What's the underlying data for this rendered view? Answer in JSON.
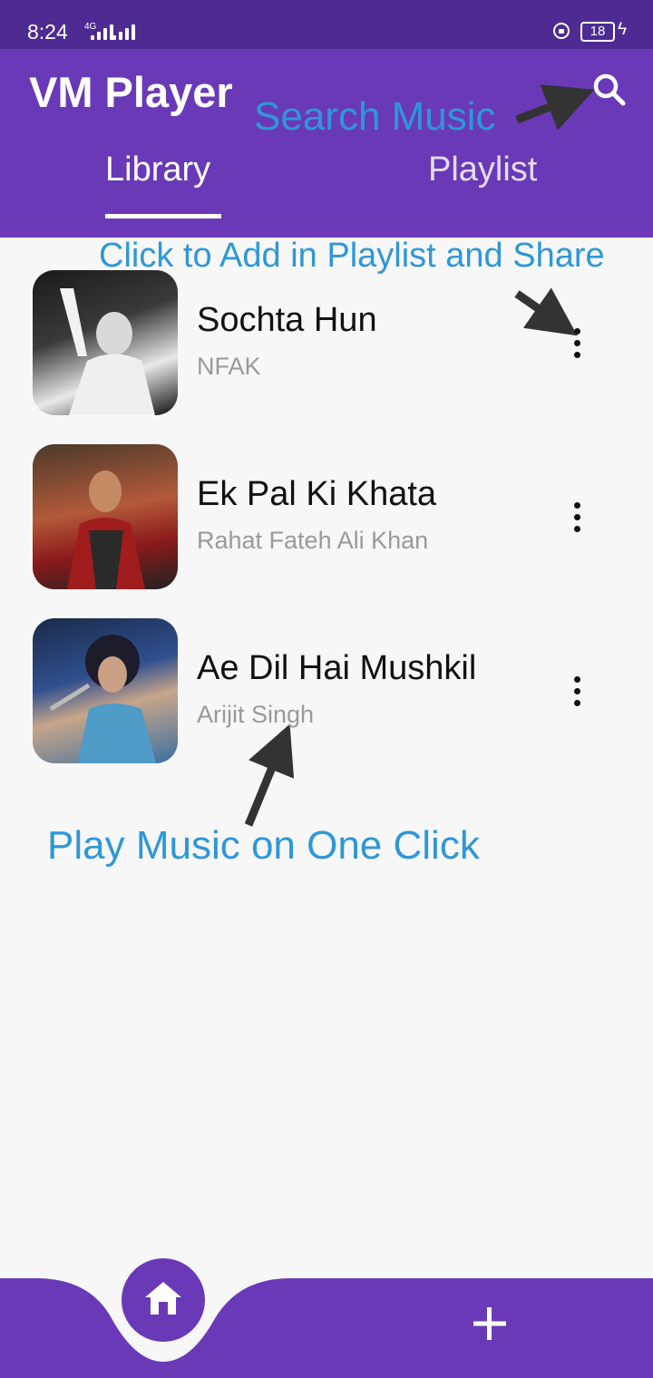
{
  "status_bar": {
    "time": "8:24",
    "network": "4G",
    "battery": "18"
  },
  "app": {
    "title": "VM Player",
    "tabs": [
      {
        "label": "Library",
        "selected": true
      },
      {
        "label": "Playlist",
        "selected": false
      }
    ]
  },
  "annotations": {
    "search": "Search Music",
    "menu": "Click to Add in Playlist and Share",
    "play": "Play Music on One Click"
  },
  "songs": [
    {
      "title": "Sochta Hun",
      "artist": "NFAK"
    },
    {
      "title": "Ek Pal Ki Khata",
      "artist": "Rahat Fateh Ali Khan"
    },
    {
      "title": "Ae Dil Hai Mushkil",
      "artist": "Arijit Singh"
    }
  ],
  "colors": {
    "primary": "#6a39b7",
    "status_bar": "#4e2b93",
    "annotation": "#2e97d8"
  },
  "icons": {
    "search": "search-icon",
    "menu": "more-vert-icon",
    "home": "home-icon",
    "add": "add-icon"
  }
}
